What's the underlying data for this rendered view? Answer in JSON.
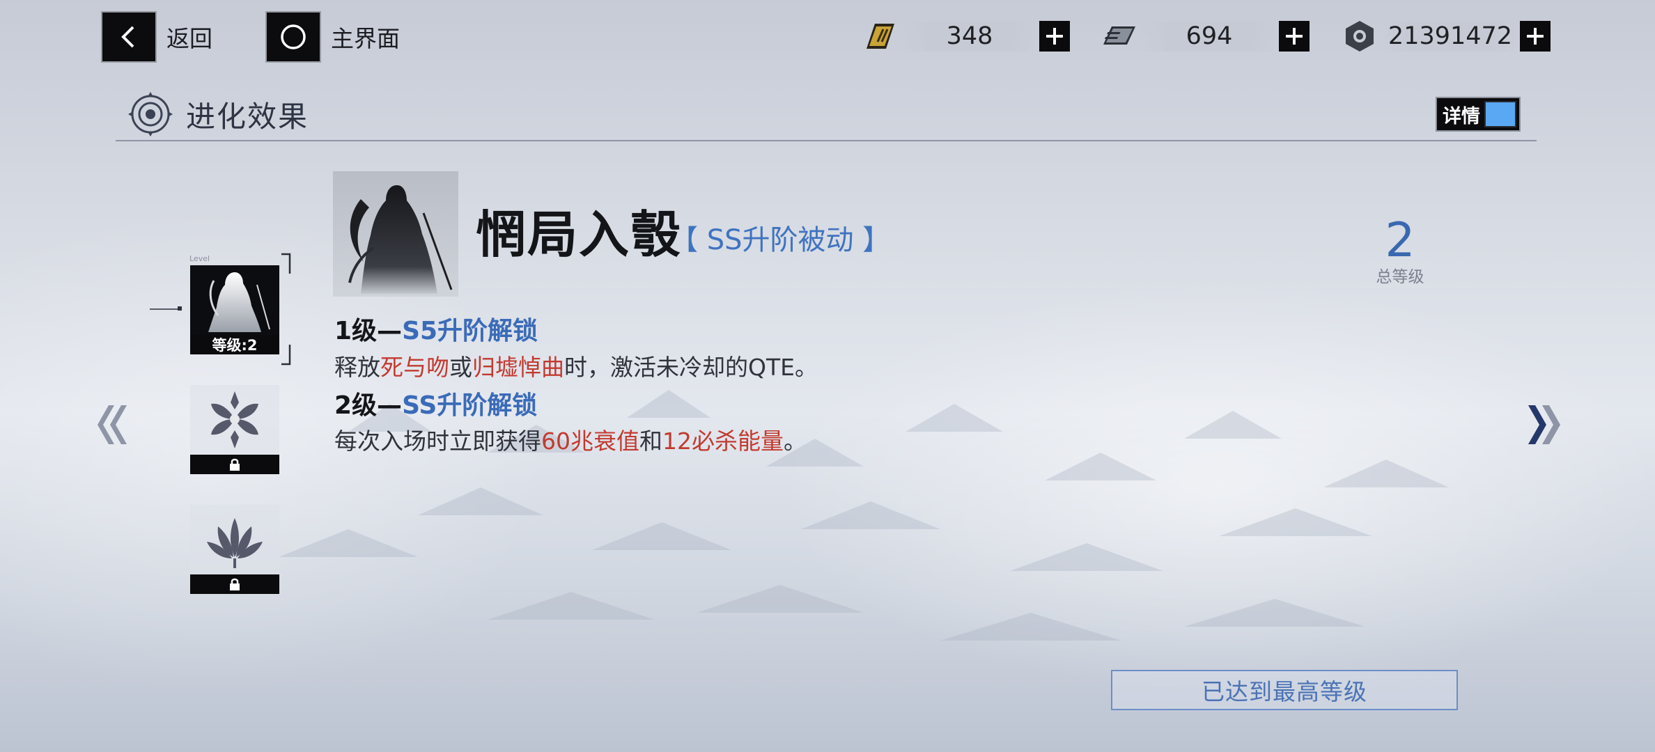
{
  "topbar": {
    "back_label": "返回",
    "home_label": "主界面",
    "resources": [
      {
        "icon": "gold-chip-icon",
        "value": "348"
      },
      {
        "icon": "memory-card-icon",
        "value": "694"
      },
      {
        "icon": "hex-nut-coin-icon",
        "value": "21391472"
      }
    ]
  },
  "header": {
    "title": "进化效果",
    "detail_label": "详情"
  },
  "sidebar": {
    "level_tag": "Level",
    "current_level_label": "等级:2"
  },
  "skill": {
    "name": "惘局入彀",
    "tag": "【 SS升阶被动 】",
    "total_level": "2",
    "total_level_caption": "总等级",
    "tiers": [
      {
        "head_prefix": "1级—",
        "head_highlight": "S5升阶解锁",
        "desc_parts": [
          "释放",
          "死与吻",
          "或",
          "归墟悼曲",
          "时，激活未冷却的QTE。"
        ]
      },
      {
        "head_prefix": "2级—",
        "head_highlight": "SS升阶解锁",
        "desc_parts": [
          "每次入场时立即获得",
          "60兆衰值",
          "和",
          "12必杀能量",
          "。"
        ]
      }
    ]
  },
  "footer": {
    "status_button": "已达到最高等级"
  },
  "colors": {
    "accent_blue": "#3a6bb8",
    "highlight_red": "#c33a2e",
    "toggle_blue": "#5aa8f4"
  }
}
